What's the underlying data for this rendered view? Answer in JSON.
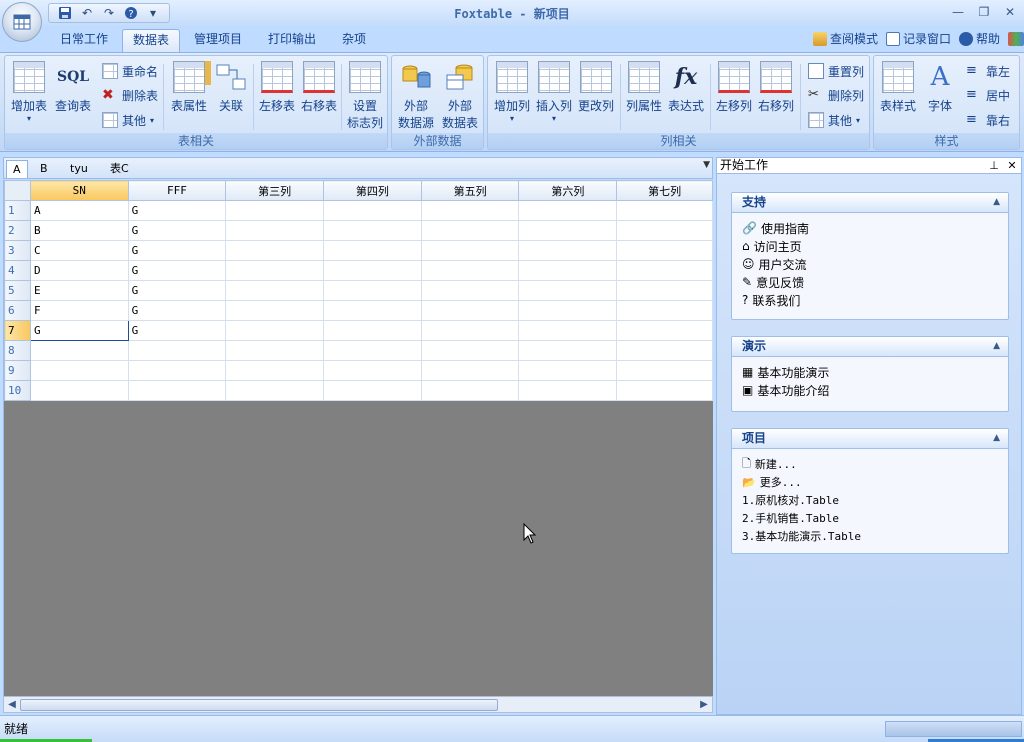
{
  "window": {
    "title": "Foxtable - 新项目",
    "controls": [
      "minimize-icon",
      "restore-icon",
      "close-icon"
    ]
  },
  "quick_access": [
    "save-icon",
    "undo-icon",
    "redo-icon",
    "help-icon",
    "dropdown-icon"
  ],
  "tabs": [
    {
      "label": "日常工作",
      "active": false
    },
    {
      "label": "数据表",
      "active": true
    },
    {
      "label": "管理项目",
      "active": false
    },
    {
      "label": "打印输出",
      "active": false
    },
    {
      "label": "杂项",
      "active": false
    }
  ],
  "right_links": [
    {
      "label": "查阅模式",
      "icon": "view-mode-icon"
    },
    {
      "label": "记录窗口",
      "icon": "record-window-icon"
    },
    {
      "label": "帮助",
      "icon": "help-icon"
    }
  ],
  "ribbon": {
    "table_group": {
      "label": "表相关",
      "add_table": "增加表",
      "query_table": "查询表",
      "sql_text": "SQL",
      "rename": "重命名",
      "delete_table": "删除表",
      "other": "其他",
      "table_props": "表属性",
      "relation": "关联",
      "move_left": "左移表",
      "move_right": "右移表",
      "set_flag_col_1": "设置",
      "set_flag_col_2": "标志列"
    },
    "external_group": {
      "label": "外部数据",
      "ext_source_1": "外部",
      "ext_source_2": "数据源",
      "ext_table_1": "外部",
      "ext_table_2": "数据表"
    },
    "column_group": {
      "label": "列相关",
      "add_col": "增加列",
      "insert_col": "插入列",
      "modify_col": "更改列",
      "col_props": "列属性",
      "expression": "表达式",
      "fx_text": "fx",
      "move_col_left": "左移列",
      "move_col_right": "右移列",
      "reset_col": "重置列",
      "delete_col": "删除列",
      "other": "其他"
    },
    "style_group": {
      "label": "样式",
      "table_style": "表样式",
      "font": "字体",
      "font_glyph": "A",
      "align_left": "靠左",
      "align_center": "居中",
      "align_right": "靠右"
    }
  },
  "doc_tabs": [
    {
      "label": "A",
      "active": true
    },
    {
      "label": "B",
      "active": false
    },
    {
      "label": "tyu",
      "active": false
    },
    {
      "label": "表C",
      "active": false
    }
  ],
  "sheet": {
    "columns": [
      "SN",
      "FFF",
      "第三列",
      "第四列",
      "第五列",
      "第六列",
      "第七列"
    ],
    "row_numbers": [
      "1",
      "2",
      "3",
      "4",
      "5",
      "6",
      "7",
      "8",
      "9",
      "10"
    ],
    "rows": [
      [
        "A",
        "G"
      ],
      [
        "B",
        "G"
      ],
      [
        "C",
        "G"
      ],
      [
        "D",
        "G"
      ],
      [
        "E",
        "G"
      ],
      [
        "F",
        "G"
      ],
      [
        "G",
        "G"
      ],
      [
        "",
        ""
      ],
      [
        "",
        ""
      ],
      [
        "",
        ""
      ]
    ],
    "selected_row": "7"
  },
  "pane": {
    "title": "开始工作",
    "support": {
      "title": "支持",
      "items": [
        "使用指南",
        "访问主页",
        "用户交流",
        "意见反馈",
        "联系我们"
      ]
    },
    "demo": {
      "title": "演示",
      "items": [
        "基本功能演示",
        "基本功能介绍"
      ]
    },
    "project": {
      "title": "项目",
      "items": [
        "新建...",
        "更多..."
      ],
      "recent": [
        "1.原机核对.Table",
        "2.手机销售.Table",
        "3.基本功能演示.Table"
      ]
    }
  },
  "status": {
    "text": "就绪"
  }
}
